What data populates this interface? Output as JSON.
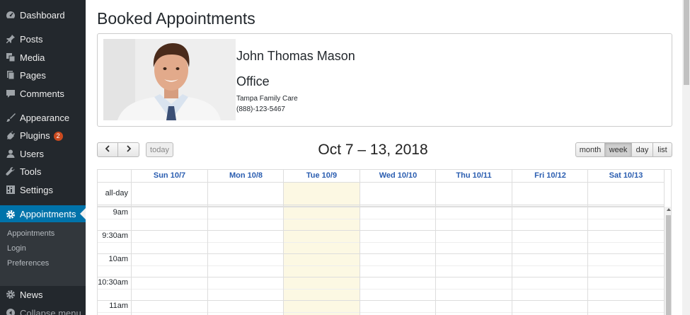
{
  "sidebar": {
    "items": [
      {
        "label": "Dashboard",
        "icon": "dashboard-icon"
      },
      {
        "label": "Posts",
        "icon": "pin-icon"
      },
      {
        "label": "Media",
        "icon": "media-icon"
      },
      {
        "label": "Pages",
        "icon": "pages-icon"
      },
      {
        "label": "Comments",
        "icon": "comment-icon"
      },
      {
        "label": "Appearance",
        "icon": "brush-icon"
      },
      {
        "label": "Plugins",
        "icon": "plug-icon",
        "badge": "2"
      },
      {
        "label": "Users",
        "icon": "user-icon"
      },
      {
        "label": "Tools",
        "icon": "wrench-icon"
      },
      {
        "label": "Settings",
        "icon": "settings-icon"
      },
      {
        "label": "Appointments",
        "icon": "gear-icon",
        "active": true
      },
      {
        "label": "News",
        "icon": "gear-icon"
      },
      {
        "label": "Collapse menu",
        "icon": "collapse-icon"
      }
    ],
    "submenu": [
      "Appointments",
      "Login",
      "Preferences"
    ]
  },
  "page": {
    "title": "Booked Appointments"
  },
  "profile": {
    "name": "John Thomas Mason",
    "role": "Office",
    "clinic": "Tampa Family Care",
    "phone": "(888)-123-5467"
  },
  "toolbar": {
    "prev_icon": "chevron-left-icon",
    "next_icon": "chevron-right-icon",
    "today_label": "today",
    "title": "Oct 7 – 13, 2018",
    "views": [
      "month",
      "week",
      "day",
      "list"
    ],
    "active_view": "week"
  },
  "calendar": {
    "days": [
      "Sun 10/7",
      "Mon 10/8",
      "Tue 10/9",
      "Wed 10/10",
      "Thu 10/11",
      "Fri 10/12",
      "Sat 10/13"
    ],
    "today_index": 2,
    "allday_label": "all-day",
    "times": [
      "9am",
      "9:30am",
      "10am",
      "10:30am",
      "11am"
    ]
  },
  "colors": {
    "sidebar_bg": "#23282d",
    "active_bg": "#0073aa",
    "badge": "#ca4a1f",
    "day_header": "#2a5db0",
    "today_highlight": "#fcf8e3"
  }
}
